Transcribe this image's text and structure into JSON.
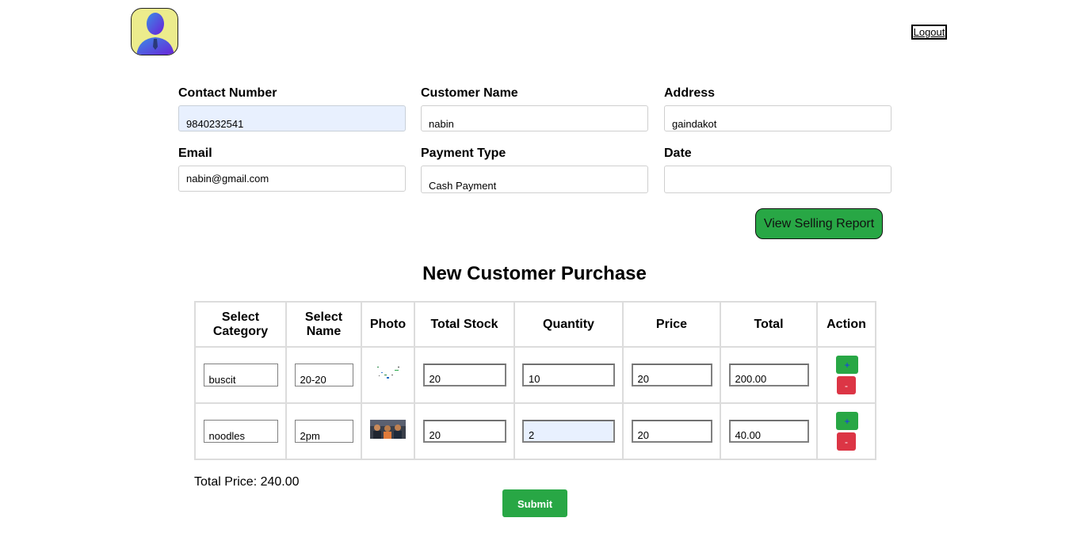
{
  "header": {
    "avatar_icon": "user-avatar-icon",
    "logout_label": "Logout"
  },
  "form": {
    "contact_number": {
      "label": "Contact Number",
      "value": "9840232541"
    },
    "customer_name": {
      "label": "Customer Name",
      "value": "nabin"
    },
    "address": {
      "label": "Address",
      "value": "gaindakot"
    },
    "email": {
      "label": "Email",
      "value": "nabin@gmail.com"
    },
    "payment_type": {
      "label": "Payment Type",
      "value": "Cash Payment"
    },
    "date": {
      "label": "Date",
      "value": ""
    }
  },
  "report_button_label": "View Selling Report",
  "section_title": "New Customer Purchase",
  "table": {
    "headers": {
      "category_line1": "Select",
      "category_line2": "Category",
      "name_line1": "Select",
      "name_line2": "Name",
      "photo": "Photo",
      "total_stock": "Total Stock",
      "quantity": "Quantity",
      "price": "Price",
      "total": "Total",
      "action": "Action"
    },
    "rows": [
      {
        "category": "buscit",
        "name": "20-20",
        "total_stock": "20",
        "quantity": "10",
        "price": "20",
        "total": "200.00",
        "plus": "+",
        "minus": "-"
      },
      {
        "category": "noodles",
        "name": "2pm",
        "total_stock": "20",
        "quantity": "2",
        "price": "20",
        "total": "40.00",
        "plus": "+",
        "minus": "-"
      }
    ]
  },
  "total_price_text": "Total Price: 240.00",
  "submit_label": "Submit",
  "colors": {
    "success": "#28a745",
    "danger": "#dc3545",
    "autofill": "#e8f0fe",
    "avatar_bg": "#ecec8c"
  }
}
